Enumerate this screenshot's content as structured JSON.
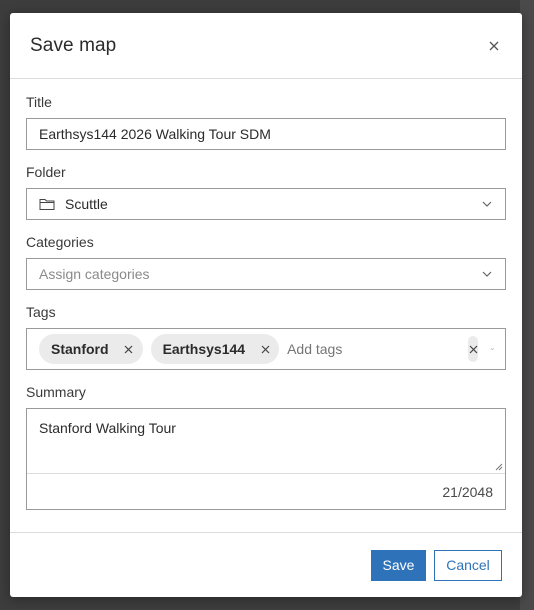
{
  "dialog": {
    "title": "Save map"
  },
  "fields": {
    "title": {
      "label": "Title",
      "value": "Earthsys144 2026 Walking Tour SDM"
    },
    "folder": {
      "label": "Folder",
      "value": "Scuttle"
    },
    "categories": {
      "label": "Categories",
      "placeholder": "Assign categories"
    },
    "tags": {
      "label": "Tags",
      "chips": [
        "Stanford",
        "Earthsys144"
      ],
      "placeholder": "Add tags"
    },
    "summary": {
      "label": "Summary",
      "value": "Stanford Walking Tour",
      "char_count": "21/2048"
    }
  },
  "footer": {
    "save_label": "Save",
    "cancel_label": "Cancel"
  },
  "colors": {
    "accent": "#2e73b9",
    "backdrop": "#3d3d3d"
  },
  "icons": {
    "close": "close-icon",
    "folder": "folder-icon",
    "chevron": "chevron-down-icon",
    "chip_remove": "x-icon",
    "clear": "clear-icon"
  }
}
